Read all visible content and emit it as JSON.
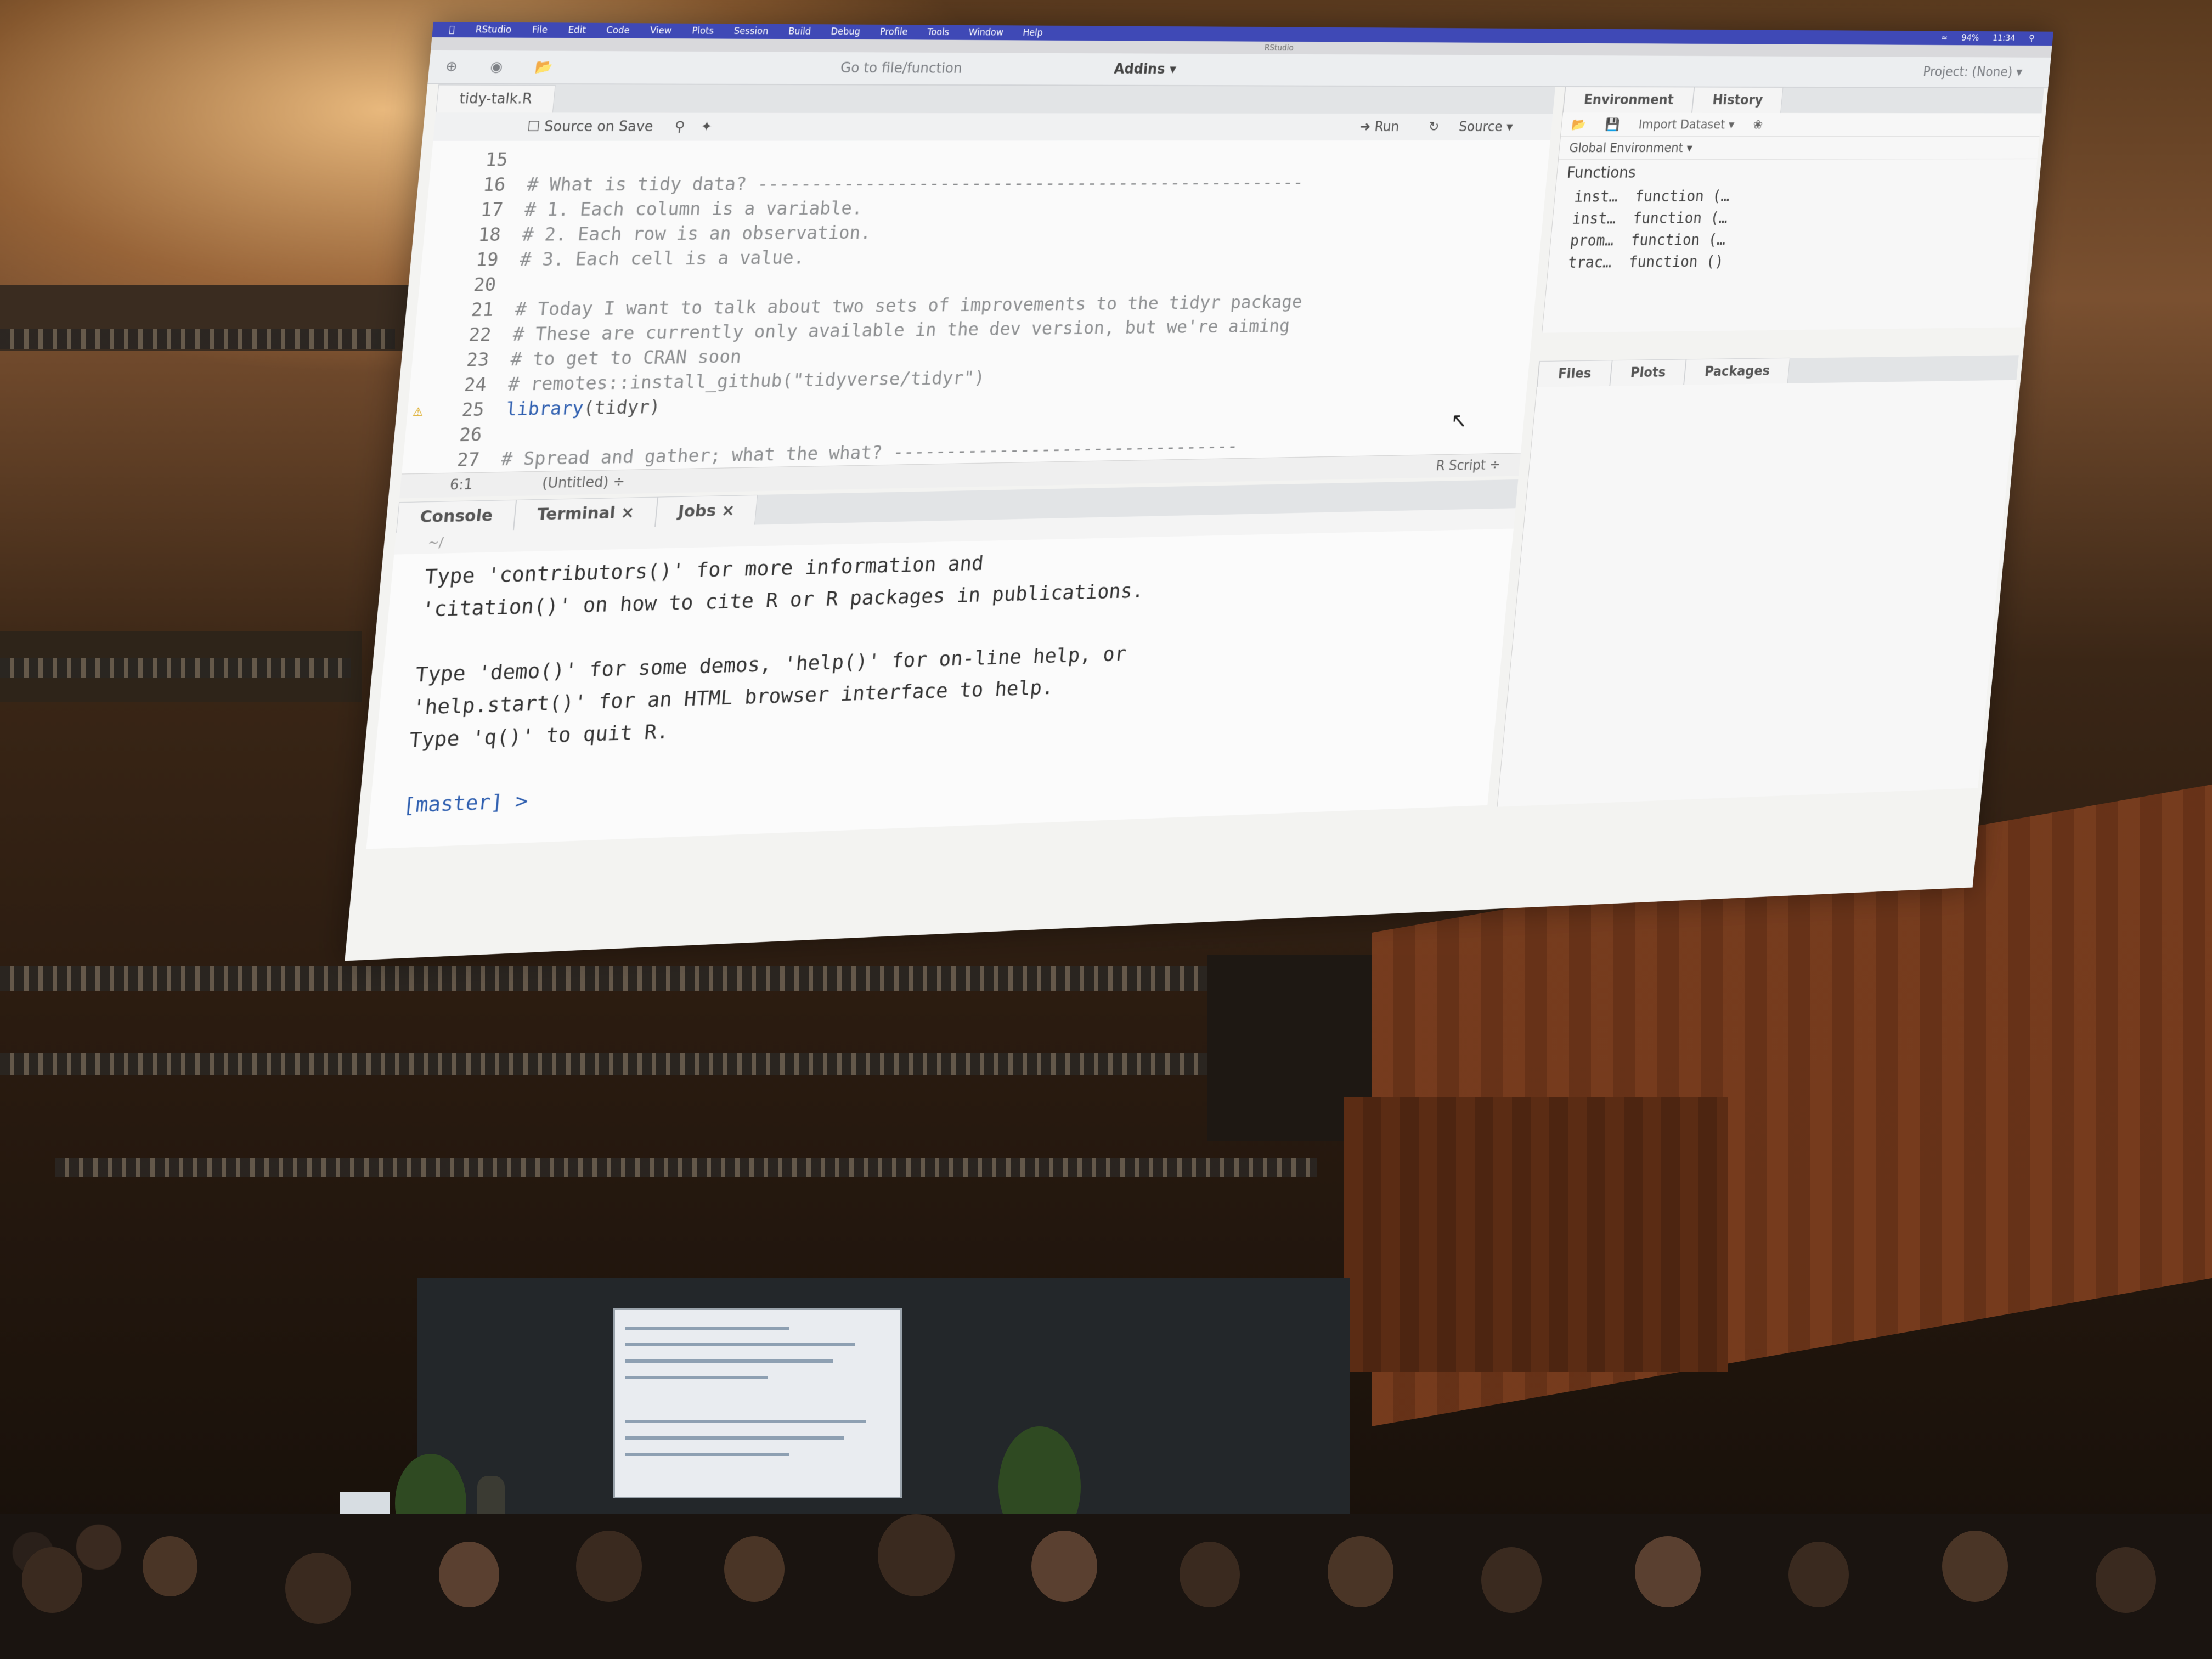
{
  "menubar": {
    "items": [
      "RStudio",
      "File",
      "Edit",
      "Code",
      "View",
      "Plots",
      "Session",
      "Build",
      "Debug",
      "Profile",
      "Tools",
      "Window",
      "Help"
    ],
    "battery": "94%",
    "clock": "11:34"
  },
  "window_title": "RStudio",
  "toolbar": {
    "goto_placeholder": "Go to file/function",
    "addins": "Addins ▾",
    "project": "Project: (None) ▾"
  },
  "source": {
    "tab": "tidy-talk.R",
    "source_on_save": "Source on Save",
    "run": "Run",
    "source_btn": "Source ▾",
    "lines": [
      {
        "n": "15",
        "text": ""
      },
      {
        "n": "16",
        "text": "# What is tidy data? ----------------------------------------------------"
      },
      {
        "n": "17",
        "text": "# 1. Each column is a variable."
      },
      {
        "n": "18",
        "text": "# 2. Each row is an observation."
      },
      {
        "n": "19",
        "text": "# 3. Each cell is a value."
      },
      {
        "n": "20",
        "text": ""
      },
      {
        "n": "21",
        "text": "# Today I want to talk about two sets of improvements to the tidyr package"
      },
      {
        "n": "22",
        "text": "# These are currently only available in the dev version, but we're aiming"
      },
      {
        "n": "23",
        "text": "# to get to CRAN soon"
      },
      {
        "n": "24",
        "text": "# remotes::install_github(\"tidyverse/tidyr\")"
      },
      {
        "n": "25",
        "text_kw": "library",
        "text_rest": "(tidyr)"
      },
      {
        "n": "26",
        "text": ""
      },
      {
        "n": "27",
        "text": "# Spread and gather; what the what? ---------------------------------"
      }
    ],
    "status_pos": "6:1",
    "status_scope": "(Untitled) ÷",
    "status_type": "R Script ÷"
  },
  "console": {
    "tabs": [
      "Console",
      "Terminal ×",
      "Jobs ×"
    ],
    "path": "~/",
    "lines": [
      "Type 'contributors()' for more information and",
      "'citation()' on how to cite R or R packages in publications.",
      "",
      "Type 'demo()' for some demos, 'help()' for on-line help, or",
      "'help.start()' for an HTML browser interface to help.",
      "Type 'q()' to quit R."
    ],
    "prompt": "[master] >"
  },
  "environment": {
    "tabs": [
      "Environment",
      "History"
    ],
    "import": "Import Dataset ▾",
    "scope": "Global Environment ▾",
    "section": "Functions",
    "rows": [
      "inst…  function (…",
      "inst…  function (…",
      "prom…  function (…",
      "trac…  function ()"
    ]
  },
  "files": {
    "tabs": [
      "Files",
      "Plots",
      "Packages"
    ]
  }
}
